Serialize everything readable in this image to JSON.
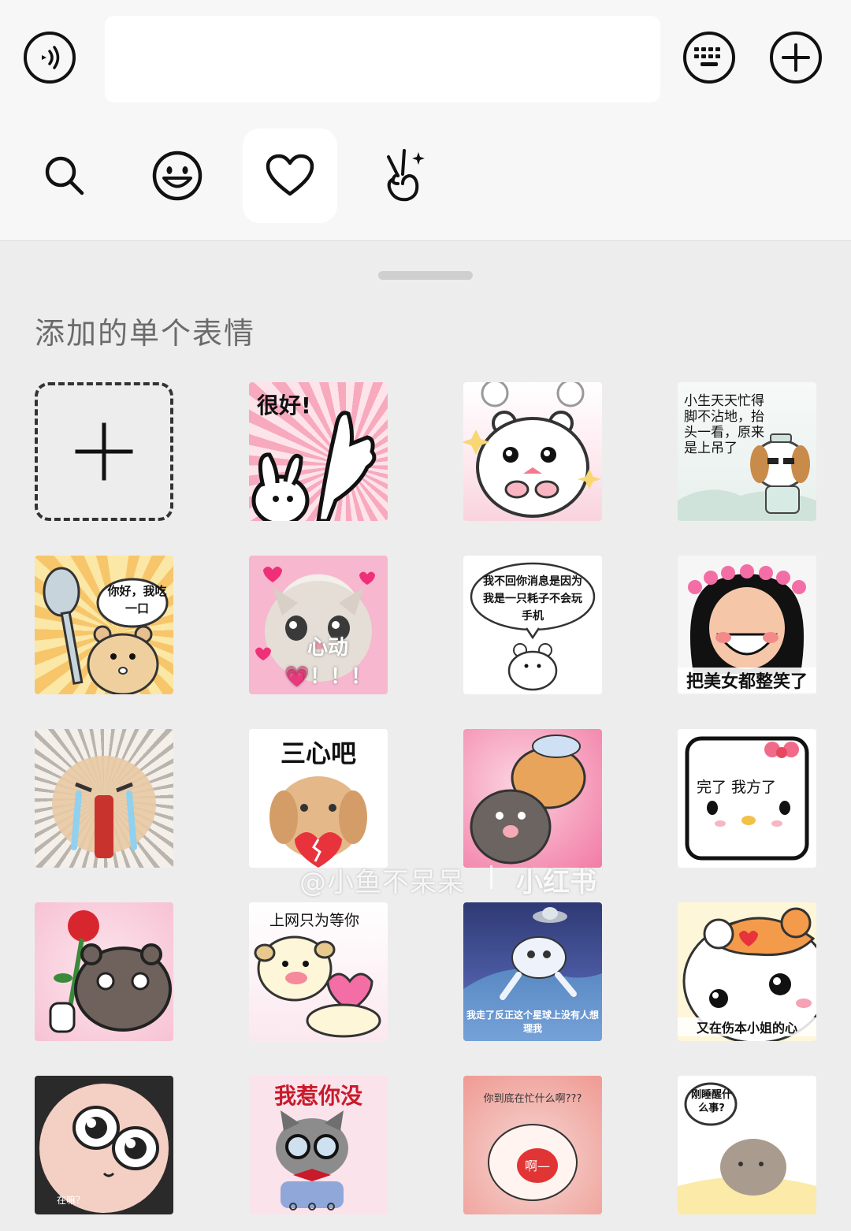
{
  "input": {
    "value": "",
    "placeholder": ""
  },
  "topbar": {
    "voice_icon": "voice-icon",
    "keyboard_icon": "keyboard-icon",
    "plus_icon": "plus-icon"
  },
  "tabs": [
    {
      "icon": "search-icon",
      "active": false
    },
    {
      "icon": "smiley-icon",
      "active": false
    },
    {
      "icon": "heart-icon",
      "active": true
    },
    {
      "icon": "gesture-icon",
      "active": false
    }
  ],
  "section": {
    "title": "添加的单个表情"
  },
  "stickers": [
    {
      "caption": "很好!"
    },
    {
      "caption": ""
    },
    {
      "caption": "小生天天忙得脚不沾地，抬头一看，原来是上吊了"
    },
    {
      "caption": "你好，我吃一口"
    },
    {
      "caption": "心动💗！！！"
    },
    {
      "caption": "我不回你消息是因为我是一只耗子不会玩手机"
    },
    {
      "caption": "把美女都整笑了"
    },
    {
      "caption": ""
    },
    {
      "caption": "三心吧"
    },
    {
      "caption": ""
    },
    {
      "caption": "完了 我方了"
    },
    {
      "caption": ""
    },
    {
      "caption": "上网只为等你"
    },
    {
      "caption": "我走了反正这个星球上没有人想理我"
    },
    {
      "caption": "又在伤本小姐的心"
    },
    {
      "caption": "在嘛？"
    },
    {
      "caption": "我惹你没"
    },
    {
      "caption": "你到底在忙什么啊???"
    },
    {
      "caption": "刚睡醒什么事?"
    }
  ],
  "watermark": {
    "text": "@小鱼不呆呆",
    "brand": "小红书"
  }
}
